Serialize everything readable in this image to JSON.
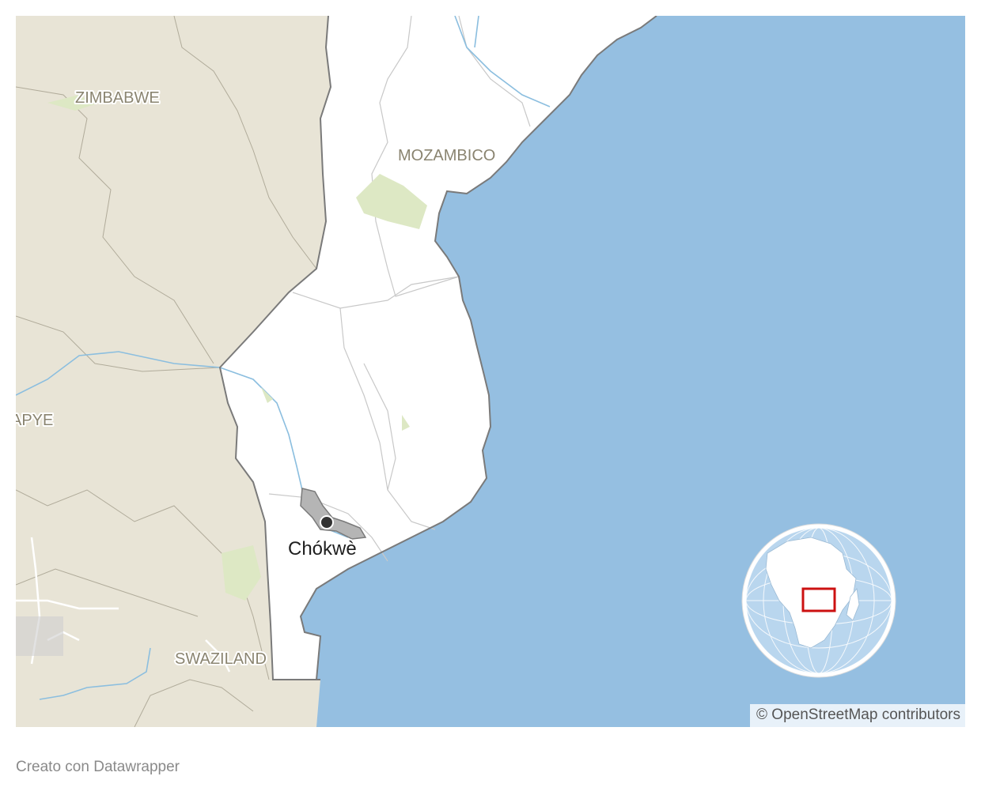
{
  "map": {
    "colors": {
      "ocean": "#95bfe1",
      "neighbor_land": "#e8e4d6",
      "mozambique_land": "#ffffff",
      "border": "#7a7a7a",
      "river": "#8bbedf",
      "vegetation": "#dde8c4",
      "highlight_district": "#b5b5b5",
      "inset_box": "#cc1111"
    },
    "labels": {
      "zimbabwe": "ZIMBABWE",
      "mozambico": "MOZAMBICO",
      "partial_left": "APYE",
      "swaziland": "SWAZILAND"
    },
    "marker": {
      "city": "Chókwè",
      "icon": "city-dot-icon"
    },
    "inset": {
      "icon": "globe-locator-icon",
      "highlight": "southern-africa-red-box"
    },
    "attribution": "© OpenStreetMap contributors"
  },
  "footer": {
    "credit": "Creato con Datawrapper"
  }
}
